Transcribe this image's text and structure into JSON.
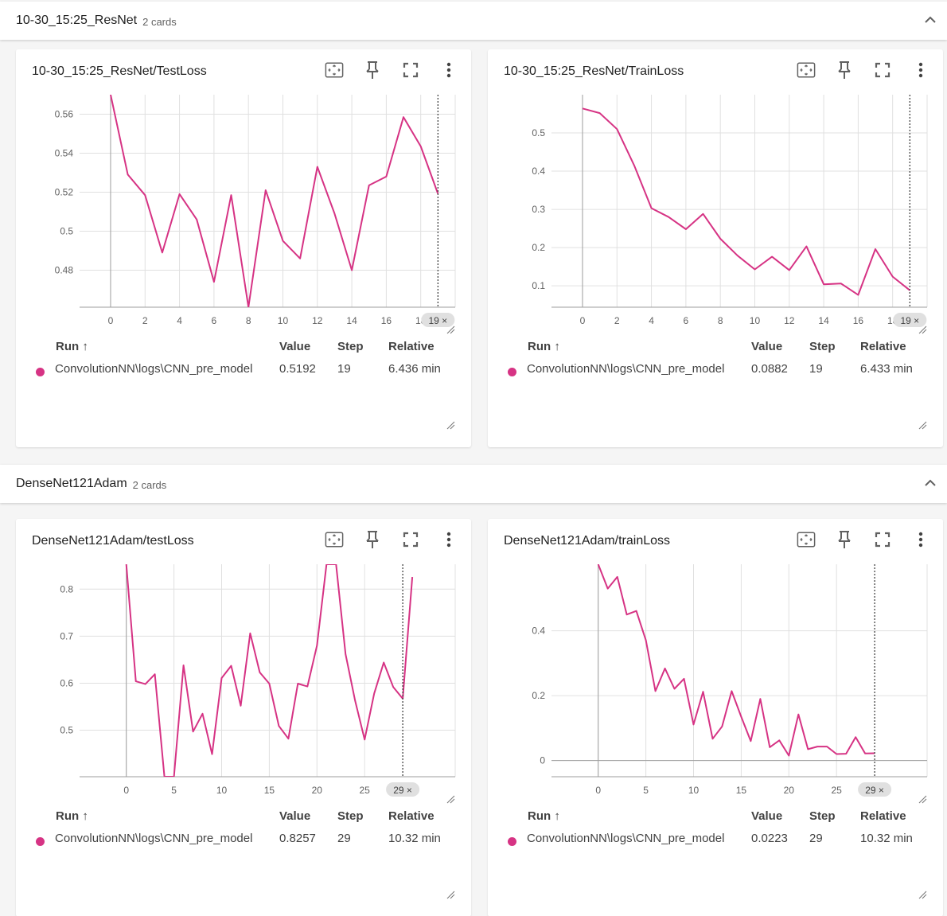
{
  "colors": {
    "series": "#d63384",
    "axis": "#9e9e9e",
    "grid": "#e0e0e0",
    "step_marker": "#424242"
  },
  "groups": [
    {
      "title": "10-30_15:25_ResNet",
      "count_label": "2 cards",
      "cards": [
        {
          "title": "10-30_15:25_ResNet/TestLoss",
          "columns": {
            "run": "Run ↑",
            "value": "Value",
            "step": "Step",
            "relative": "Relative"
          },
          "row": {
            "run": "ConvolutionNN\\logs\\CNN_pre_model",
            "value": "0.5192",
            "step": "19",
            "relative": "6.436 min"
          },
          "step_badge": "19 ×",
          "chart_data": {
            "type": "line",
            "x_ticks": [
              "0",
              "2",
              "4",
              "6",
              "8",
              "10",
              "12",
              "14",
              "16",
              "18"
            ],
            "y_ticks": [
              "0.48",
              "0.5",
              "0.52",
              "0.54",
              "0.56"
            ],
            "xlim": [
              -1.8,
              20.0
            ],
            "ylim": [
              0.461,
              0.57
            ],
            "cursor_step": 19,
            "series": [
              {
                "values": [
                  {
                    "x": 0,
                    "y": 0.57
                  },
                  {
                    "x": 1,
                    "y": 0.529
                  },
                  {
                    "x": 2,
                    "y": 0.5185
                  },
                  {
                    "x": 3,
                    "y": 0.489
                  },
                  {
                    "x": 4,
                    "y": 0.519
                  },
                  {
                    "x": 5,
                    "y": 0.506
                  },
                  {
                    "x": 6,
                    "y": 0.474
                  },
                  {
                    "x": 7,
                    "y": 0.5185
                  },
                  {
                    "x": 8,
                    "y": 0.461
                  },
                  {
                    "x": 9,
                    "y": 0.521
                  },
                  {
                    "x": 10,
                    "y": 0.495
                  },
                  {
                    "x": 11,
                    "y": 0.486
                  },
                  {
                    "x": 12,
                    "y": 0.533
                  },
                  {
                    "x": 13,
                    "y": 0.509
                  },
                  {
                    "x": 14,
                    "y": 0.48
                  },
                  {
                    "x": 15,
                    "y": 0.5235
                  },
                  {
                    "x": 16,
                    "y": 0.528
                  },
                  {
                    "x": 17,
                    "y": 0.5585
                  },
                  {
                    "x": 18,
                    "y": 0.5435
                  },
                  {
                    "x": 19,
                    "y": 0.5192
                  }
                ]
              }
            ]
          }
        },
        {
          "title": "10-30_15:25_ResNet/TrainLoss",
          "columns": {
            "run": "Run ↑",
            "value": "Value",
            "step": "Step",
            "relative": "Relative"
          },
          "row": {
            "run": "ConvolutionNN\\logs\\CNN_pre_model",
            "value": "0.0882",
            "step": "19",
            "relative": "6.433 min"
          },
          "step_badge": "19 ×",
          "chart_data": {
            "type": "line",
            "x_ticks": [
              "0",
              "2",
              "4",
              "6",
              "8",
              "10",
              "12",
              "14",
              "16",
              "18"
            ],
            "y_ticks": [
              "0.1",
              "0.2",
              "0.3",
              "0.4",
              "0.5"
            ],
            "xlim": [
              -1.8,
              20.0
            ],
            "ylim": [
              0.044,
              0.6
            ],
            "cursor_step": 19,
            "series": [
              {
                "values": [
                  {
                    "x": 0,
                    "y": 0.564
                  },
                  {
                    "x": 1,
                    "y": 0.552
                  },
                  {
                    "x": 2,
                    "y": 0.51
                  },
                  {
                    "x": 3,
                    "y": 0.415
                  },
                  {
                    "x": 4,
                    "y": 0.303
                  },
                  {
                    "x": 5,
                    "y": 0.28
                  },
                  {
                    "x": 6,
                    "y": 0.248
                  },
                  {
                    "x": 7,
                    "y": 0.288
                  },
                  {
                    "x": 8,
                    "y": 0.223
                  },
                  {
                    "x": 9,
                    "y": 0.179
                  },
                  {
                    "x": 10,
                    "y": 0.143
                  },
                  {
                    "x": 11,
                    "y": 0.176
                  },
                  {
                    "x": 12,
                    "y": 0.141
                  },
                  {
                    "x": 13,
                    "y": 0.203
                  },
                  {
                    "x": 14,
                    "y": 0.104
                  },
                  {
                    "x": 15,
                    "y": 0.106
                  },
                  {
                    "x": 16,
                    "y": 0.076
                  },
                  {
                    "x": 17,
                    "y": 0.196
                  },
                  {
                    "x": 18,
                    "y": 0.124
                  },
                  {
                    "x": 19,
                    "y": 0.0882
                  }
                ]
              }
            ]
          }
        }
      ]
    },
    {
      "title": "DenseNet121Adam",
      "count_label": "2 cards",
      "cards": [
        {
          "title": "DenseNet121Adam/testLoss",
          "columns": {
            "run": "Run ↑",
            "value": "Value",
            "step": "Step",
            "relative": "Relative"
          },
          "row": {
            "run": "ConvolutionNN\\logs\\CNN_pre_model",
            "value": "0.8257",
            "step": "29",
            "relative": "10.32 min"
          },
          "step_badge": "29 ×",
          "chart_data": {
            "type": "line",
            "x_ticks": [
              "0",
              "5",
              "10",
              "15",
              "20",
              "25"
            ],
            "y_ticks": [
              "0.5",
              "0.6",
              "0.7",
              "0.8"
            ],
            "xlim": [
              -4.9,
              34.5
            ],
            "ylim": [
              0.401,
              0.853
            ],
            "cursor_step": 29,
            "series": [
              {
                "values": [
                  {
                    "x": 0,
                    "y": 0.853
                  },
                  {
                    "x": 1,
                    "y": 0.604
                  },
                  {
                    "x": 2,
                    "y": 0.598
                  },
                  {
                    "x": 3,
                    "y": 0.619
                  },
                  {
                    "x": 4,
                    "y": 0.401
                  },
                  {
                    "x": 5,
                    "y": 0.401
                  },
                  {
                    "x": 6,
                    "y": 0.638
                  },
                  {
                    "x": 7,
                    "y": 0.497
                  },
                  {
                    "x": 8,
                    "y": 0.535
                  },
                  {
                    "x": 9,
                    "y": 0.449
                  },
                  {
                    "x": 10,
                    "y": 0.611
                  },
                  {
                    "x": 11,
                    "y": 0.637
                  },
                  {
                    "x": 12,
                    "y": 0.552
                  },
                  {
                    "x": 13,
                    "y": 0.706
                  },
                  {
                    "x": 14,
                    "y": 0.623
                  },
                  {
                    "x": 15,
                    "y": 0.599
                  },
                  {
                    "x": 16,
                    "y": 0.509
                  },
                  {
                    "x": 17,
                    "y": 0.482
                  },
                  {
                    "x": 18,
                    "y": 0.599
                  },
                  {
                    "x": 19,
                    "y": 0.593
                  },
                  {
                    "x": 20,
                    "y": 0.68
                  },
                  {
                    "x": 21,
                    "y": 0.853
                  },
                  {
                    "x": 22,
                    "y": 0.853
                  },
                  {
                    "x": 23,
                    "y": 0.662
                  },
                  {
                    "x": 24,
                    "y": 0.563
                  },
                  {
                    "x": 25,
                    "y": 0.48
                  },
                  {
                    "x": 26,
                    "y": 0.578
                  },
                  {
                    "x": 27,
                    "y": 0.644
                  },
                  {
                    "x": 28,
                    "y": 0.592
                  },
                  {
                    "x": 29,
                    "y": 0.567
                  },
                  {
                    "x": 30,
                    "y": 0.8257
                  }
                ]
              }
            ]
          }
        },
        {
          "title": "DenseNet121Adam/trainLoss",
          "columns": {
            "run": "Run ↑",
            "value": "Value",
            "step": "Step",
            "relative": "Relative"
          },
          "row": {
            "run": "ConvolutionNN\\logs\\CNN_pre_model",
            "value": "0.0223",
            "step": "29",
            "relative": "10.32 min"
          },
          "step_badge": "29 ×",
          "chart_data": {
            "type": "line",
            "x_ticks": [
              "0",
              "5",
              "10",
              "15",
              "20",
              "25"
            ],
            "y_ticks": [
              "0",
              "0.2",
              "0.4"
            ],
            "xlim": [
              -4.9,
              34.5
            ],
            "ylim": [
              -0.05,
              0.605
            ],
            "cursor_step": 29,
            "series": [
              {
                "values": [
                  {
                    "x": 0,
                    "y": 0.605
                  },
                  {
                    "x": 1,
                    "y": 0.53
                  },
                  {
                    "x": 2,
                    "y": 0.566
                  },
                  {
                    "x": 3,
                    "y": 0.45
                  },
                  {
                    "x": 4,
                    "y": 0.461
                  },
                  {
                    "x": 5,
                    "y": 0.371
                  },
                  {
                    "x": 6,
                    "y": 0.214
                  },
                  {
                    "x": 7,
                    "y": 0.284
                  },
                  {
                    "x": 8,
                    "y": 0.221
                  },
                  {
                    "x": 9,
                    "y": 0.252
                  },
                  {
                    "x": 10,
                    "y": 0.111
                  },
                  {
                    "x": 11,
                    "y": 0.212
                  },
                  {
                    "x": 12,
                    "y": 0.067
                  },
                  {
                    "x": 13,
                    "y": 0.105
                  },
                  {
                    "x": 14,
                    "y": 0.214
                  },
                  {
                    "x": 15,
                    "y": 0.135
                  },
                  {
                    "x": 16,
                    "y": 0.06
                  },
                  {
                    "x": 17,
                    "y": 0.19
                  },
                  {
                    "x": 18,
                    "y": 0.041
                  },
                  {
                    "x": 19,
                    "y": 0.062
                  },
                  {
                    "x": 20,
                    "y": 0.015
                  },
                  {
                    "x": 21,
                    "y": 0.142
                  },
                  {
                    "x": 22,
                    "y": 0.035
                  },
                  {
                    "x": 23,
                    "y": 0.043
                  },
                  {
                    "x": 24,
                    "y": 0.043
                  },
                  {
                    "x": 25,
                    "y": 0.02
                  },
                  {
                    "x": 26,
                    "y": 0.021
                  },
                  {
                    "x": 27,
                    "y": 0.072
                  },
                  {
                    "x": 28,
                    "y": 0.022
                  },
                  {
                    "x": 29,
                    "y": 0.0223
                  }
                ]
              }
            ]
          }
        }
      ]
    }
  ]
}
